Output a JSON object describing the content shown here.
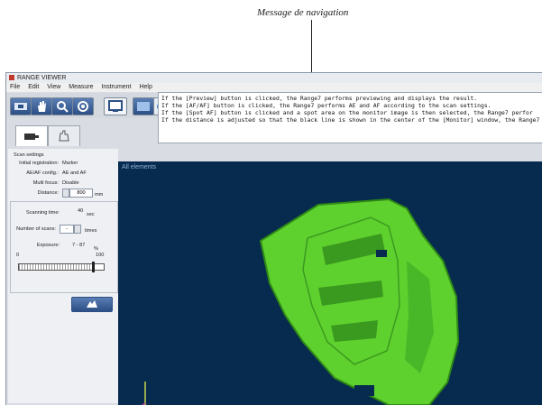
{
  "annotation": {
    "label": "Message de navigation"
  },
  "window": {
    "title": "RANGE VIEWER"
  },
  "menu": [
    "File",
    "Edit",
    "View",
    "Measure",
    "Instrument",
    "Help"
  ],
  "toolbar": {
    "icons": [
      "scan-icon",
      "hand-icon",
      "zoom-icon",
      "rotate-icon",
      "monitor-icon",
      "settings-icon"
    ]
  },
  "message": {
    "lines": [
      "If the [Preview] button is clicked, the Range7 performs previewing and displays the result.",
      "If the [AF/AF] button is clicked, the Range7 performs AE and AF according to the scan settings.",
      "If the [Spot AF] button is clicked and a spot area on the monitor image is then selected, the Range7 perfor",
      "If the distance is adjusted so that the black line is shown in the center of the [Monitor] window, the Range7"
    ]
  },
  "tabs": [
    {
      "icon": "scanner-tab-icon",
      "active": true
    },
    {
      "icon": "hand-tab-icon",
      "active": false
    }
  ],
  "settings": {
    "header": "Scan settings",
    "initial_registration": {
      "label": "Initial registration:",
      "value": "Marker"
    },
    "aeaf_config": {
      "label": "AE/AF config.:",
      "value": "AE and AF"
    },
    "multi_focus": {
      "label": "Multi focus:",
      "value": "Disable"
    },
    "distance": {
      "label": "Distance:",
      "value": "800",
      "unit": "mm"
    },
    "scanning_time": {
      "label": "Scanning time:",
      "value": "40",
      "unit": "sec"
    },
    "number_of_scans": {
      "label": "Number of scans:",
      "value": "-",
      "unit": "times"
    },
    "exposure": {
      "label": "Exposure:",
      "value": "7 - 87",
      "unit": "%"
    },
    "slider": {
      "min_label": "0",
      "max_label": "100",
      "level_fraction": 0.87
    },
    "scan_button": {
      "icon": "scan-start-icon"
    }
  },
  "viewport": {
    "label": "All elements",
    "model_color": "#5fd12e",
    "background_color": "#072a4f",
    "axis_y_color": "#c8d84a",
    "axis_x_color": "#c83fb0"
  }
}
